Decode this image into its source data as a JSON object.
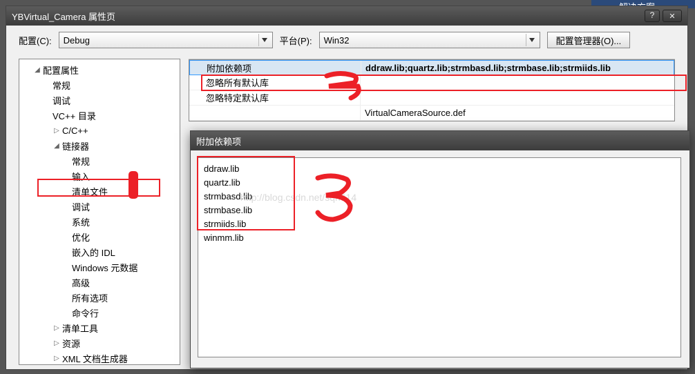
{
  "frag_text": "解决方案",
  "window": {
    "title": "YBVirtual_Camera 属性页"
  },
  "toolbar": {
    "config_label": "配置(C):",
    "config_value": "Debug",
    "platform_label": "平台(P):",
    "platform_value": "Win32",
    "manager_btn": "配置管理器(O)..."
  },
  "tree": {
    "root": "配置属性",
    "items_lv2a": [
      "常规",
      "调试",
      "VC++ 目录"
    ],
    "ccpp": "C/C++",
    "linker": "链接器",
    "linker_children": [
      "常规",
      "输入",
      "清单文件",
      "调试",
      "系统",
      "优化",
      "嵌入的 IDL",
      "Windows 元数据",
      "高级",
      "所有选项",
      "命令行"
    ],
    "manifest_tool": "清单工具",
    "resources": "资源",
    "xml_doc": "XML 文档生成器"
  },
  "props": {
    "rows": [
      {
        "name": "附加依赖项",
        "val": "ddraw.lib;quartz.lib;strmbasd.lib;strmbase.lib;strmiids.lib"
      },
      {
        "name": "忽略所有默认库",
        "val": ""
      },
      {
        "name": "忽略特定默认库",
        "val": ""
      }
    ],
    "hidden_row_val": "VirtualCameraSource.def"
  },
  "popup": {
    "title": "附加依赖项",
    "items": [
      "ddraw.lib",
      "quartz.lib",
      "strmbasd.lib",
      "strmbase.lib",
      "strmiids.lib",
      "winmm.lib"
    ]
  },
  "watermark": "http://blog.csdn.net/sqn614"
}
